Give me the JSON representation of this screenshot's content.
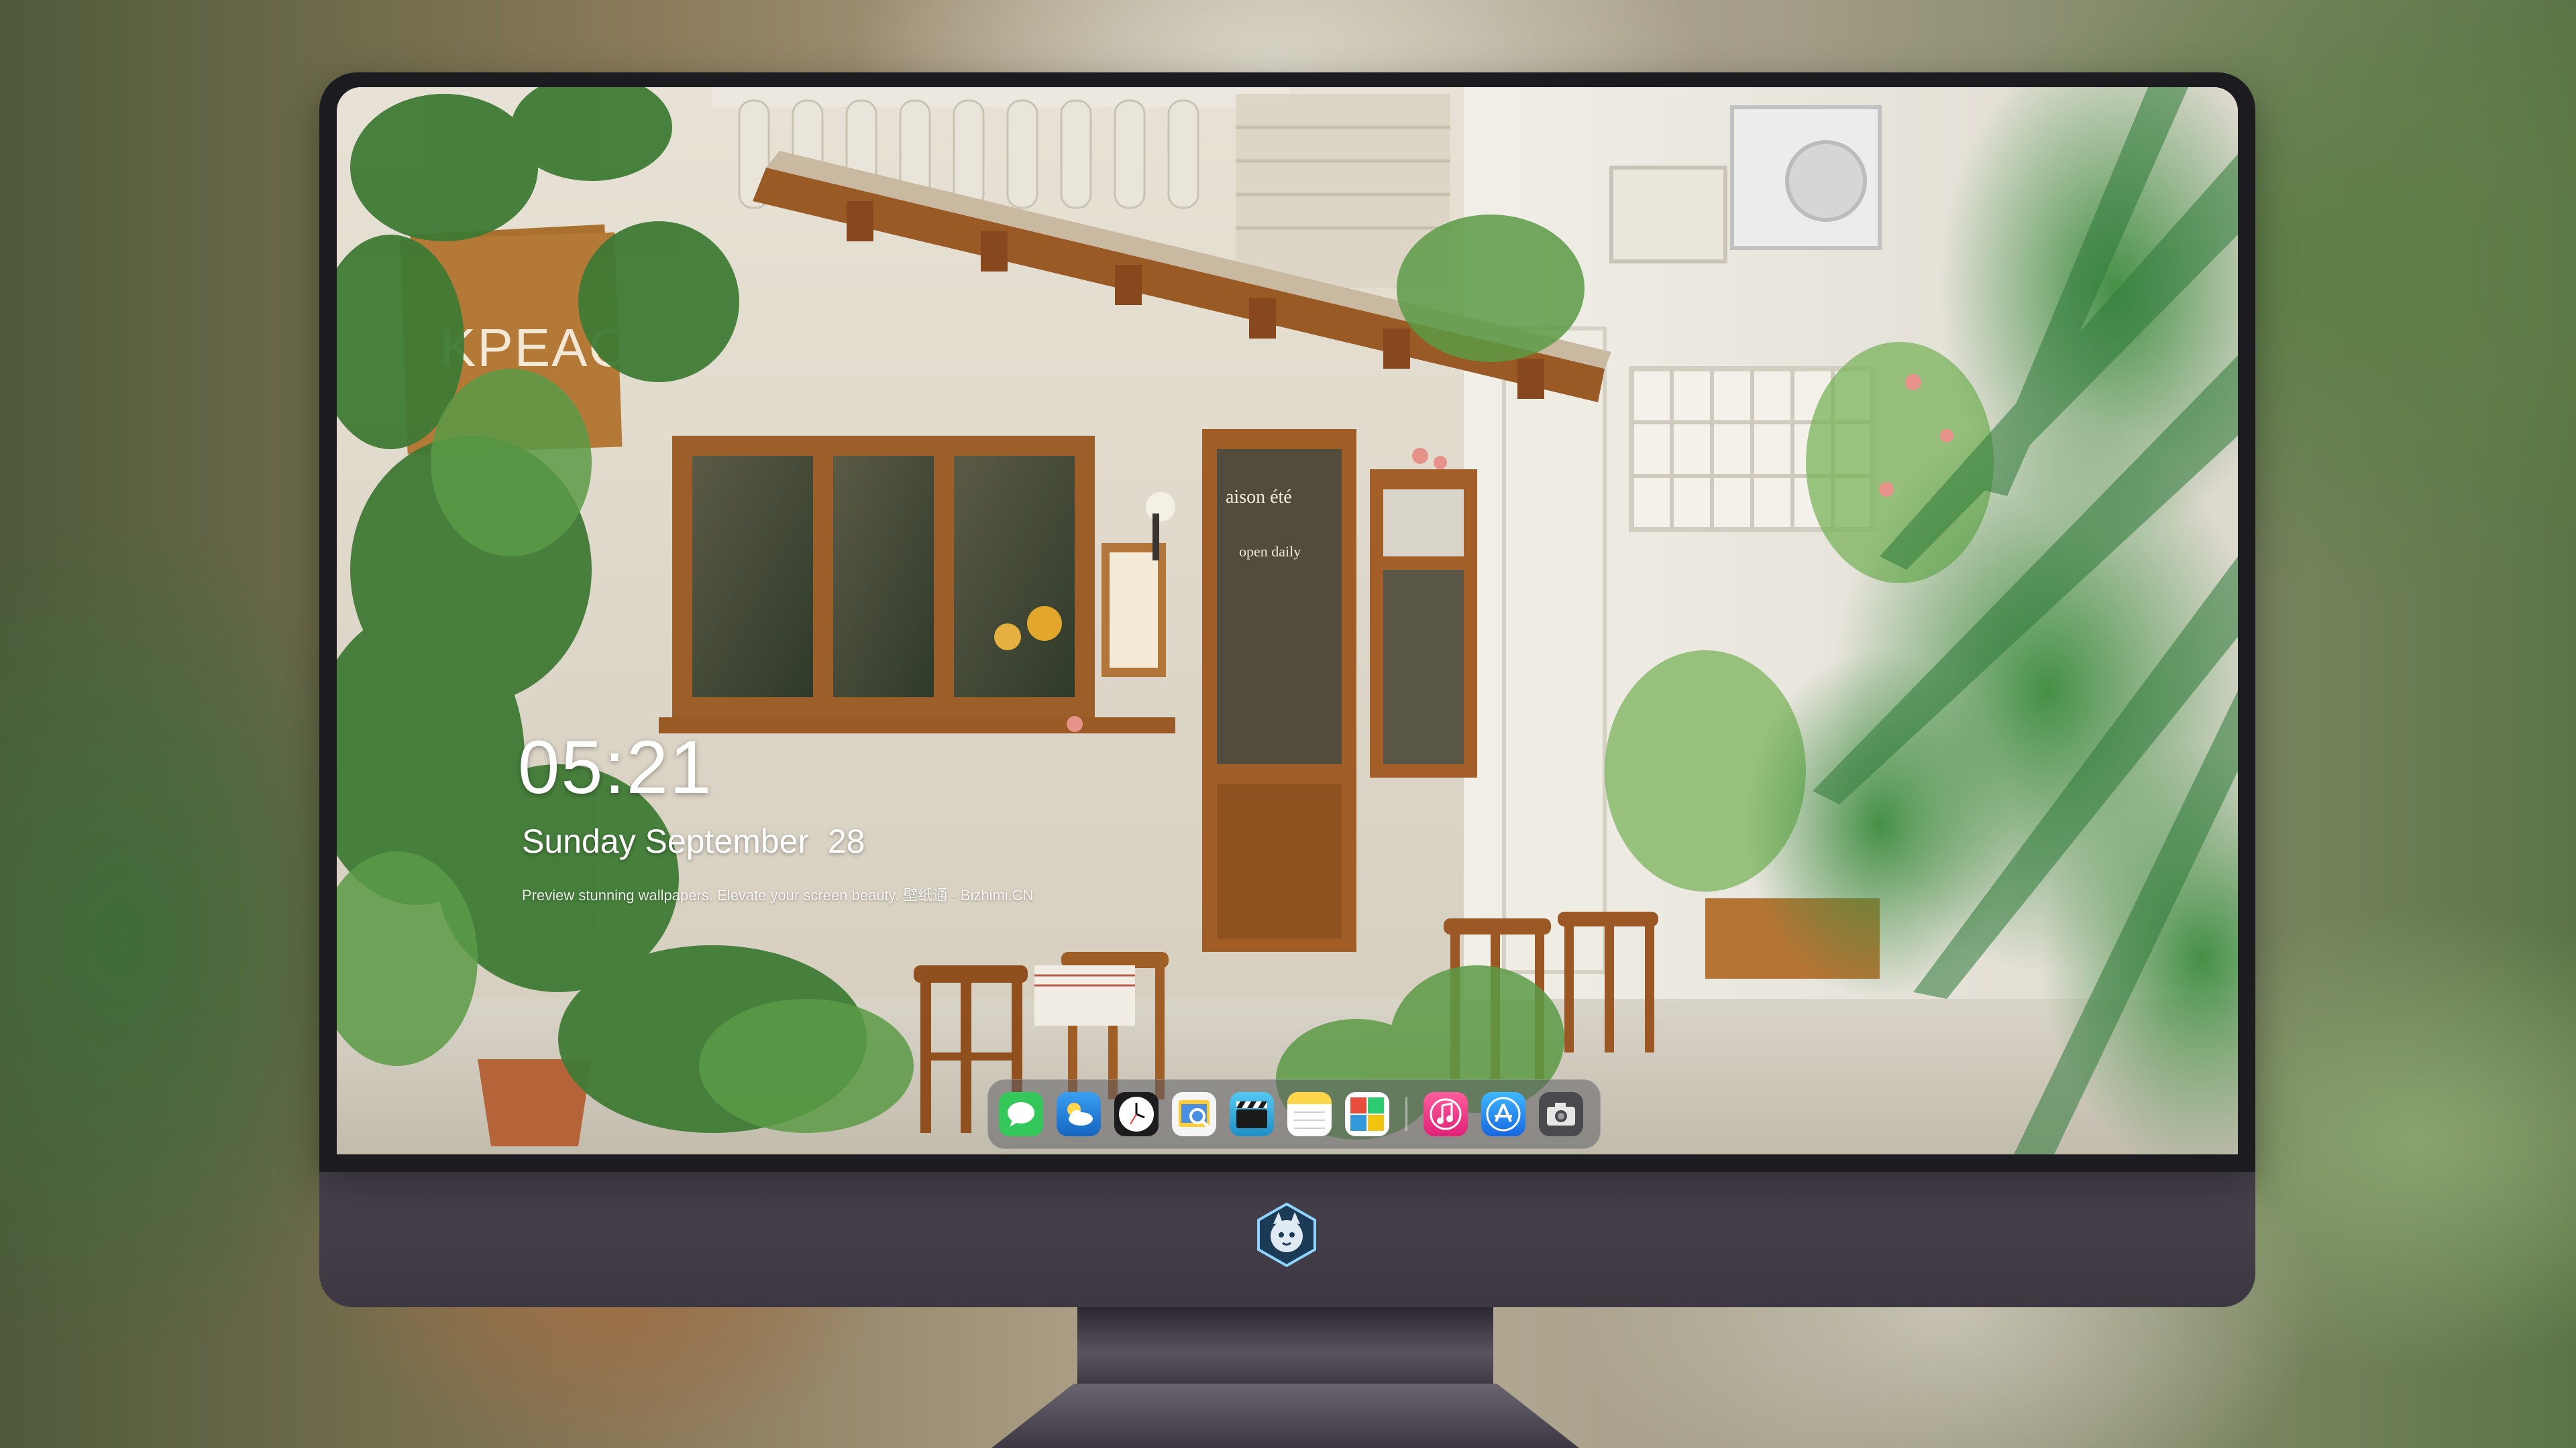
{
  "lock_screen": {
    "time": "05:21",
    "date": "Sunday September  28",
    "tagline": "Preview stunning wallpapers. Elevate your screen beauty. 壁纸通 · Bizhimi.CN"
  },
  "wallpaper": {
    "shop_sign": "KPEACE",
    "door_text": "aison été",
    "door_sub": "open daily"
  },
  "dock": {
    "apps": [
      {
        "icon": "messages-icon",
        "color": "#34c759"
      },
      {
        "icon": "weather-icon",
        "color": "#1e88e5"
      },
      {
        "icon": "clock-icon",
        "color": "#ffffff"
      },
      {
        "icon": "preview-icon",
        "color": "#ffcc33"
      },
      {
        "icon": "clapper-icon",
        "color": "#3db6e8"
      },
      {
        "icon": "notes-icon",
        "color": "#ffd54a"
      },
      {
        "icon": "photo-booth-icon",
        "color": "#e74c3c"
      },
      {
        "icon": "music-icon",
        "color": "#fb3c7a"
      },
      {
        "icon": "app-store-icon",
        "color": "#1f8ef1"
      },
      {
        "icon": "camera-icon",
        "color": "#8e8e93"
      }
    ]
  },
  "colors": {
    "bezel": "#1c1b20",
    "chin": "#433d48",
    "wood": "#a8682f"
  }
}
